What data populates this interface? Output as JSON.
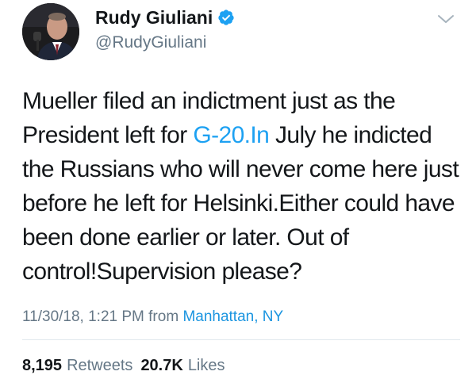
{
  "user": {
    "display_name": "Rudy Giuliani",
    "handle": "@RudyGiuliani",
    "verified": true
  },
  "tweet": {
    "text_part1": "Mueller filed an indictment just as the President left for ",
    "link_text": "G-20.In",
    "text_part2": " July he indicted the Russians who will never come here just before he left for Helsinki.Either could have been done earlier or later. Out of control!Supervision please?",
    "timestamp": "11/30/18, 1:21 PM",
    "from_label": "from",
    "location": "Manhattan, NY"
  },
  "stats": {
    "retweets_count": "8,195",
    "retweets_label": "Retweets",
    "likes_count": "20.7K",
    "likes_label": "Likes"
  },
  "colors": {
    "link": "#1da1f2",
    "verified_badge": "#1da1f2",
    "muted": "#657786"
  },
  "icons": {
    "verified": "verified-badge-icon",
    "menu": "chevron-down-icon"
  }
}
